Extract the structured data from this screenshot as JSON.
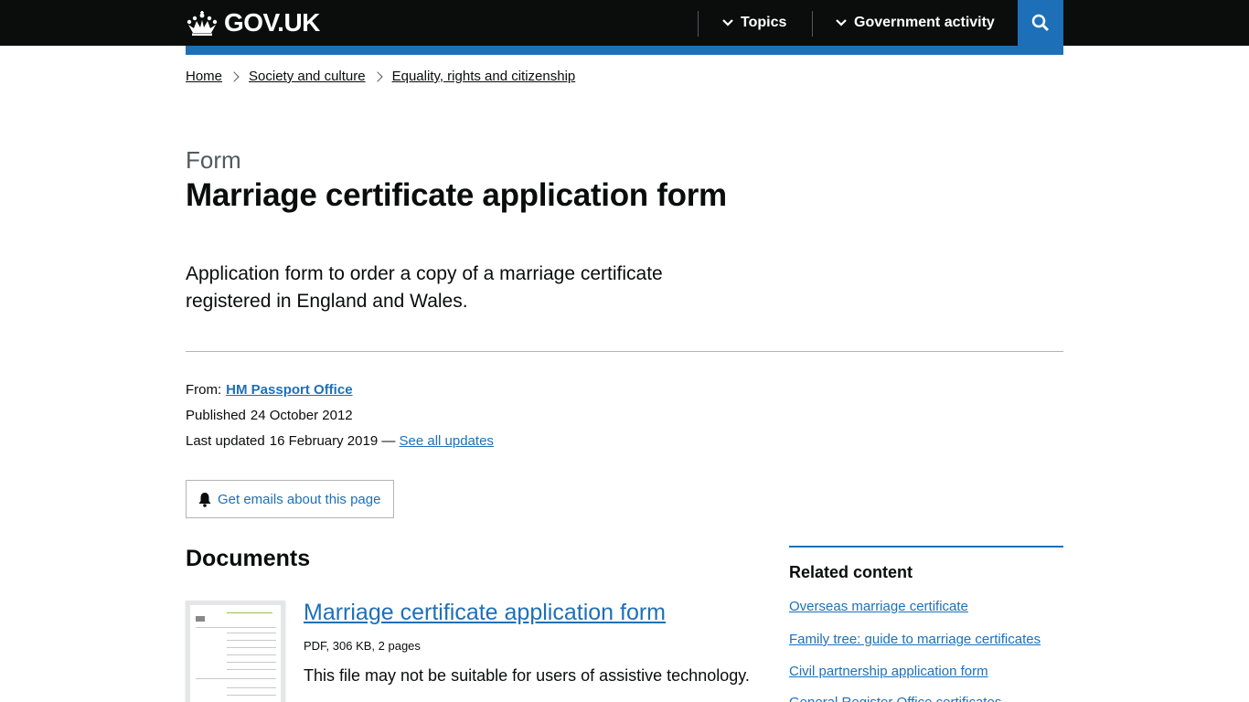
{
  "header": {
    "logo_text": "GOV.UK",
    "nav": [
      {
        "label": "Topics"
      },
      {
        "label": "Government activity"
      }
    ]
  },
  "breadcrumbs": [
    "Home",
    "Society and culture",
    "Equality, rights and citizenship"
  ],
  "page": {
    "caption": "Form",
    "title": "Marriage certificate application form",
    "lead": "Application form to order a copy of a marriage certificate registered in England and Wales."
  },
  "metadata": {
    "from_label": "From:",
    "from_org": "HM Passport Office",
    "published_label": "Published",
    "published_date": "24 October 2012",
    "updated_label": "Last updated",
    "updated_date": "16 February 2019 —",
    "see_updates": "See all updates"
  },
  "email_button": {
    "label": "Get emails about this page"
  },
  "documents": {
    "heading": "Documents",
    "items": [
      {
        "title": "Marriage certificate application form",
        "meta": "PDF, 306 KB, 2 pages",
        "note": "This file may not be suitable for users of assistive technology."
      }
    ]
  },
  "related": {
    "heading": "Related content",
    "links": [
      "Overseas marriage certificate",
      "Family tree: guide to marriage certificates",
      "Civil partnership application form",
      "General Register Office certificates"
    ]
  },
  "colors": {
    "header_bg": "#0b0c0c",
    "link": "#1d70b8",
    "secondary_text": "#505a5f",
    "border": "#b1b4b6"
  }
}
